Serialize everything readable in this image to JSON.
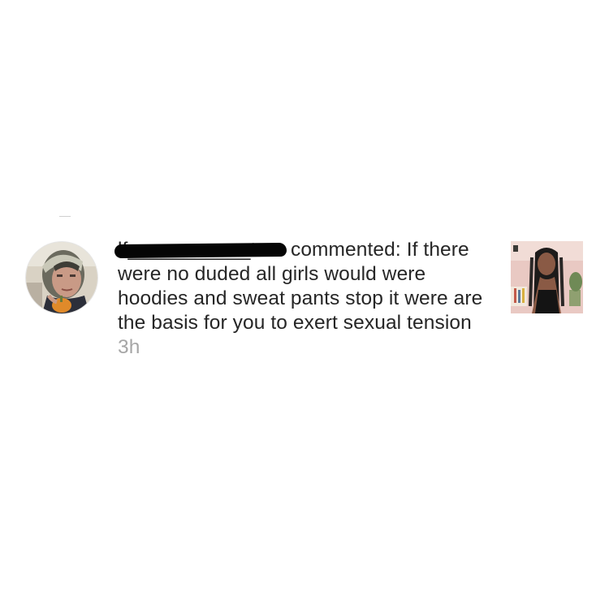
{
  "notification": {
    "username": "lf___________tore",
    "action_text": " commented: ",
    "comment": "If there were no duded all girls would were hoodies and sweat pants stop it were are the basis for you to exert sexual tension",
    "timestamp": " 3h"
  },
  "colors": {
    "text": "#262626",
    "timestamp": "#a6a6a6",
    "redaction": "#050505",
    "background": "#ffffff"
  }
}
